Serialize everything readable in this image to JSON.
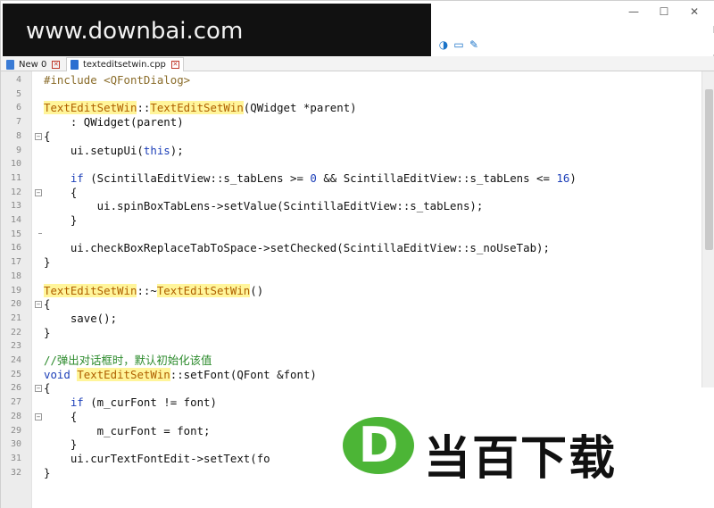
{
  "window": {
    "controls": {
      "minimize": "—",
      "maximize": "☐",
      "close": "✕"
    }
  },
  "watermark": {
    "text": "www.downbai.com"
  },
  "toolbar": {
    "icons": [
      "contrast-icon",
      "chat-icon",
      "edit-pen-icon"
    ]
  },
  "tabs": [
    {
      "label": "New 0",
      "active": false
    },
    {
      "label": "texteditsetwin.cpp",
      "active": true
    }
  ],
  "colors": {
    "keyword": "#1c3fb8",
    "highlight": "#fff59a",
    "highlight_text": "#b06000",
    "comment": "#2b8a2b",
    "logo_green": "#4cb536"
  },
  "editor": {
    "line_numbers": [
      "4",
      "5",
      "6",
      "7",
      "8",
      "9",
      "10",
      "11",
      "12",
      "13",
      "14",
      "15",
      "16",
      "17",
      "18",
      "19",
      "20",
      "21",
      "22",
      "23",
      "24",
      "25",
      "26",
      "27",
      "28",
      "29",
      "30",
      "31",
      "32"
    ],
    "lines": {
      "l4": "#include <QFontDialog>",
      "l6a": "TextEditSetWin",
      "l6b": "::",
      "l6c": "TextEditSetWin",
      "l6d": "(QWidget *parent)",
      "l7": "    : QWidget(parent)",
      "l8": "{",
      "l9a": "    ui.setupUi(",
      "l9b": "this",
      "l9c": ");",
      "l11a": "    ",
      "l11b": "if",
      "l11c": " (ScintillaEditView::s_tabLens >= ",
      "l11d": "0",
      "l11e": " && ScintillaEditView::s_tabLens <= ",
      "l11f": "16",
      "l11g": ")",
      "l12": "    {",
      "l13": "        ui.spinBoxTabLens->setValue(ScintillaEditView::s_tabLens);",
      "l14": "    }",
      "l16": "    ui.checkBoxReplaceTabToSpace->setChecked(ScintillaEditView::s_noUseTab);",
      "l17": "}",
      "l19a": "TextEditSetWin",
      "l19b": "::~",
      "l19c": "TextEditSetWin",
      "l19d": "()",
      "l20": "{",
      "l21": "    save();",
      "l22": "}",
      "l24": "//弹出对话框时，默认初始化该值",
      "l25a": "void",
      "l25b": " ",
      "l25c": "TextEditSetWin",
      "l25d": "::setFont(QFont &font)",
      "l26": "{",
      "l27a": "    ",
      "l27b": "if",
      "l27c": " (m_curFont != font)",
      "l28": "    {",
      "l29": "        m_curFont = font;",
      "l30": "    }",
      "l31": "    ui.curTextFontEdit->setText(fo",
      "l32": "}"
    }
  },
  "logo": {
    "letter": "D",
    "text": "当百下载"
  }
}
